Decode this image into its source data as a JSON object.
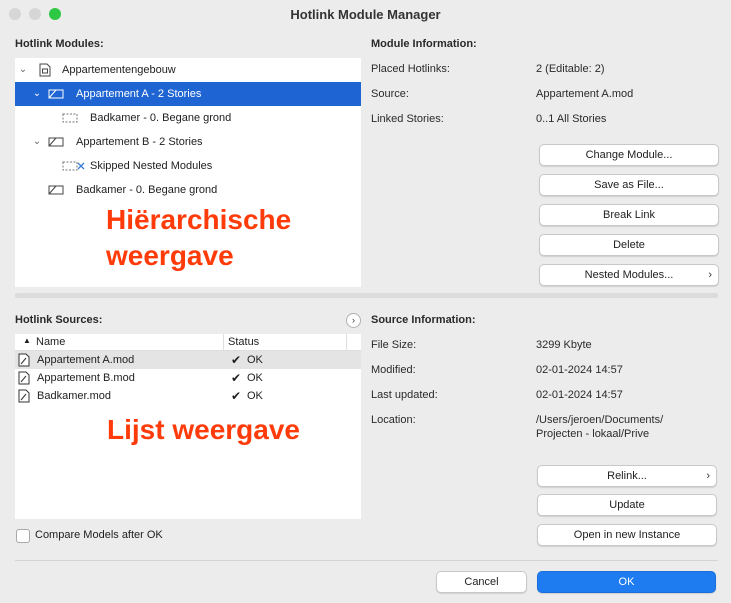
{
  "window": {
    "title": "Hotlink Module Manager"
  },
  "modules": {
    "label": "Hotlink Modules:",
    "tree": [
      {
        "label": "Appartementengebouw",
        "icon": "file-icon",
        "selected": false
      },
      {
        "label": "Appartement A - 2 Stories",
        "icon": "module-icon",
        "selected": true
      },
      {
        "label": "Badkamer - 0. Begane grond",
        "icon": "module-dashed-icon",
        "selected": false
      },
      {
        "label": "Appartement B - 2 Stories",
        "icon": "module-icon",
        "selected": false
      },
      {
        "label": "Skipped Nested Modules",
        "icon": "module-skipped-icon",
        "selected": false
      },
      {
        "label": "Badkamer - 0. Begane grond",
        "icon": "module-icon",
        "selected": false
      }
    ],
    "overlay_line1": "Hiërarchische",
    "overlay_line2": "weergave"
  },
  "module_info": {
    "label": "Module Information:",
    "rows": [
      {
        "label": "Placed Hotlinks:",
        "value": "2 (Editable: 2)"
      },
      {
        "label": "Source:",
        "value": "Appartement A.mod"
      },
      {
        "label": "Linked Stories:",
        "value": "0..1 All Stories"
      }
    ],
    "buttons": {
      "change": "Change Module...",
      "save": "Save as File...",
      "break": "Break Link",
      "delete": "Delete",
      "nested": "Nested Modules..."
    }
  },
  "sources": {
    "label": "Hotlink Sources:",
    "col_name": "Name",
    "col_status": "Status",
    "rows": [
      {
        "name": "Appartement A.mod",
        "status": "OK"
      },
      {
        "name": "Appartement B.mod",
        "status": "OK"
      },
      {
        "name": "Badkamer.mod",
        "status": "OK"
      }
    ],
    "overlay": "Lijst weergave"
  },
  "source_info": {
    "label": "Source Information:",
    "file_size_label": "File Size:",
    "file_size": "3299 Kbyte",
    "modified_label": "Modified:",
    "modified": "02-01-2024 14:57",
    "updated_label": "Last updated:",
    "updated": "02-01-2024 14:57",
    "location_label": "Location:",
    "location_line1": "/Users/jeroen/Documents/",
    "location_line2": "Projecten - lokaal/Prive",
    "buttons": {
      "relink": "Relink...",
      "update": "Update",
      "open": "Open in new Instance"
    }
  },
  "footer": {
    "compare_label": "Compare Models after OK",
    "cancel": "Cancel",
    "ok": "OK"
  },
  "colors": {
    "selection": "#1e64d2",
    "accent": "#1e7bf0",
    "overlay": "#ff3b0a"
  }
}
